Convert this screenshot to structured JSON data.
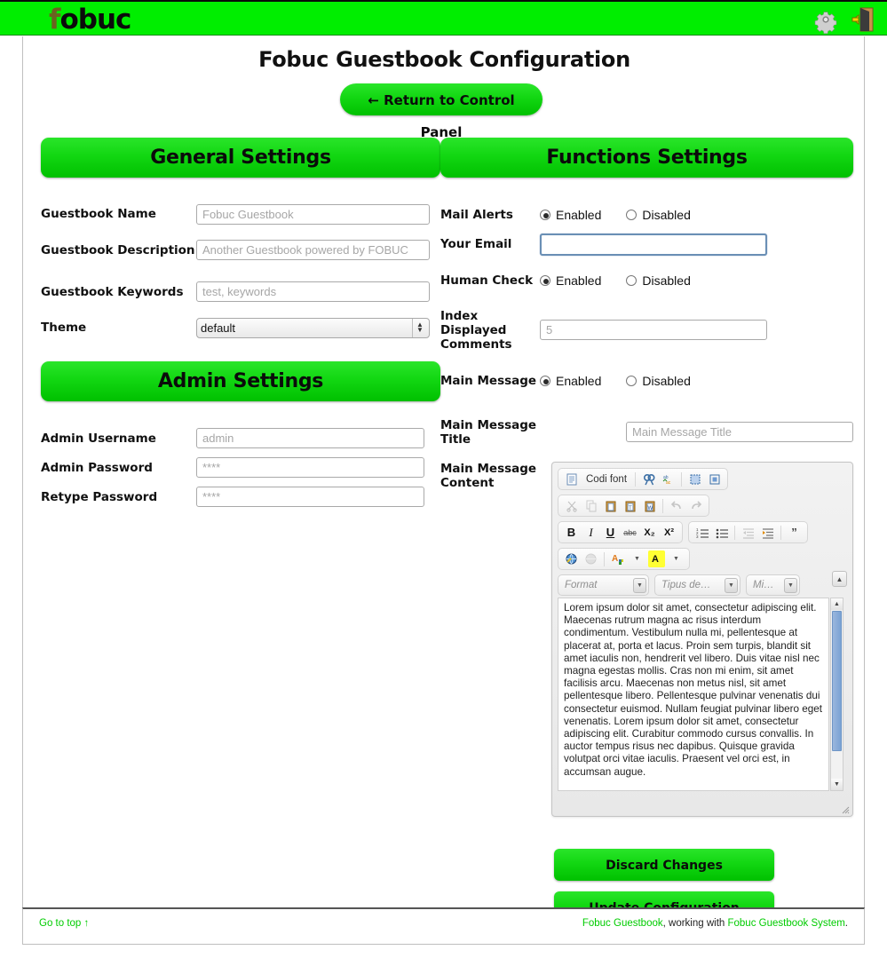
{
  "header": {
    "logo_text": "fobuc",
    "logo_f": "f",
    "logo_rest": "obuc",
    "icons": [
      {
        "name": "gear-icon",
        "title": "Settings"
      },
      {
        "name": "exit-door-icon",
        "title": "Log out"
      }
    ]
  },
  "page": {
    "title": "Fobuc Guestbook Configuration",
    "return_button": "← Return to Control Panel"
  },
  "general": {
    "heading": "General Settings",
    "fields": [
      {
        "label": "Guestbook Name",
        "placeholder": "Fobuc Guestbook",
        "value": "",
        "type": "text"
      },
      {
        "label": "Guestbook Description",
        "placeholder": "Another Guestbook powered by FOBUC",
        "value": "",
        "type": "text"
      },
      {
        "label": "Guestbook Keywords",
        "placeholder": "test, keywords",
        "value": "",
        "type": "text"
      },
      {
        "label": "Theme",
        "value": "default",
        "type": "select",
        "options": [
          "default"
        ]
      }
    ]
  },
  "admin": {
    "heading": "Admin Settings",
    "fields": [
      {
        "label": "Admin Username",
        "placeholder": "admin",
        "value": "",
        "type": "text"
      },
      {
        "label": "Admin Password",
        "placeholder": "****",
        "value": "",
        "type": "password"
      },
      {
        "label": "Retype Password",
        "placeholder": "****",
        "value": "",
        "type": "password"
      }
    ]
  },
  "functions": {
    "heading": "Functions Settings",
    "radio_enabled": "Enabled",
    "radio_disabled": "Disabled",
    "mail_alerts": {
      "label": "Mail Alerts",
      "selected": "Enabled"
    },
    "your_email": {
      "label": "Your Email",
      "value": "",
      "placeholder": "",
      "focused": true
    },
    "human_check": {
      "label": "Human Check",
      "selected": "Enabled"
    },
    "index_comments": {
      "label": "Index Displayed Comments",
      "placeholder": "5",
      "value": ""
    },
    "main_message": {
      "label": "Main Message",
      "selected": "Enabled"
    },
    "main_message_title": {
      "label": "Main Message Title",
      "placeholder": "Main Message Title",
      "value": ""
    },
    "main_message_content": {
      "label": "Main Message Content"
    }
  },
  "editor": {
    "toolbar_row1": {
      "source_label": "Codi font",
      "buttons": [
        "document-icon",
        "find-icon",
        "replace-icon",
        "select-all-icon",
        "show-blocks-icon"
      ]
    },
    "toolbar_row2": {
      "buttons": [
        "cut-icon",
        "copy-icon",
        "paste-icon",
        "paste-text-icon",
        "paste-word-icon",
        "undo-icon",
        "redo-icon"
      ]
    },
    "toolbar_row3": {
      "bold": "B",
      "italic": "I",
      "underline": "U",
      "strike": "abc",
      "subscript": "X₂",
      "superscript": "X²",
      "buttons": [
        "numbered-list-icon",
        "bulleted-list-icon",
        "outdent-icon",
        "indent-icon",
        "blockquote-icon"
      ]
    },
    "toolbar_row4": {
      "buttons": [
        "link-icon",
        "unlink-icon",
        "text-color-icon",
        "background-color-icon"
      ]
    },
    "combos": [
      {
        "label": "Format"
      },
      {
        "label": "Tipus de…"
      },
      {
        "label": "Mi…"
      }
    ],
    "content": "Lorem ipsum dolor sit amet, consectetur adipiscing elit. Maecenas rutrum magna ac risus interdum condimentum. Vestibulum nulla mi, pellentesque at placerat at, porta et lacus. Proin sem turpis, blandit sit amet iaculis non, hendrerit vel libero. Duis vitae nisl nec magna egestas mollis. Cras non mi enim, sit amet facilisis arcu. Maecenas non metus nisl, sit amet pellentesque libero. Pellentesque pulvinar venenatis dui consectetur euismod. Nullam feugiat pulvinar libero eget venenatis. Lorem ipsum dolor sit amet, consectetur adipiscing elit. Curabitur commodo cursus convallis. In auctor tempus risus nec dapibus. Quisque gravida volutpat orci vitae iaculis. Praesent vel orci est, in accumsan augue."
  },
  "actions": {
    "discard": "Discard Changes",
    "update": "Update Configuration"
  },
  "footer": {
    "go_to_top": "Go to top ↑",
    "brand": "Fobuc Guestbook",
    "middle": ", working with ",
    "system": "Fobuc Guestbook System",
    "period": "."
  },
  "colors": {
    "brand_green": "#00ee00",
    "button_green_top": "#2ae52a",
    "button_green_bottom": "#00c000",
    "link_green": "#00cc00",
    "focus_blue": "#6a8fb5"
  }
}
